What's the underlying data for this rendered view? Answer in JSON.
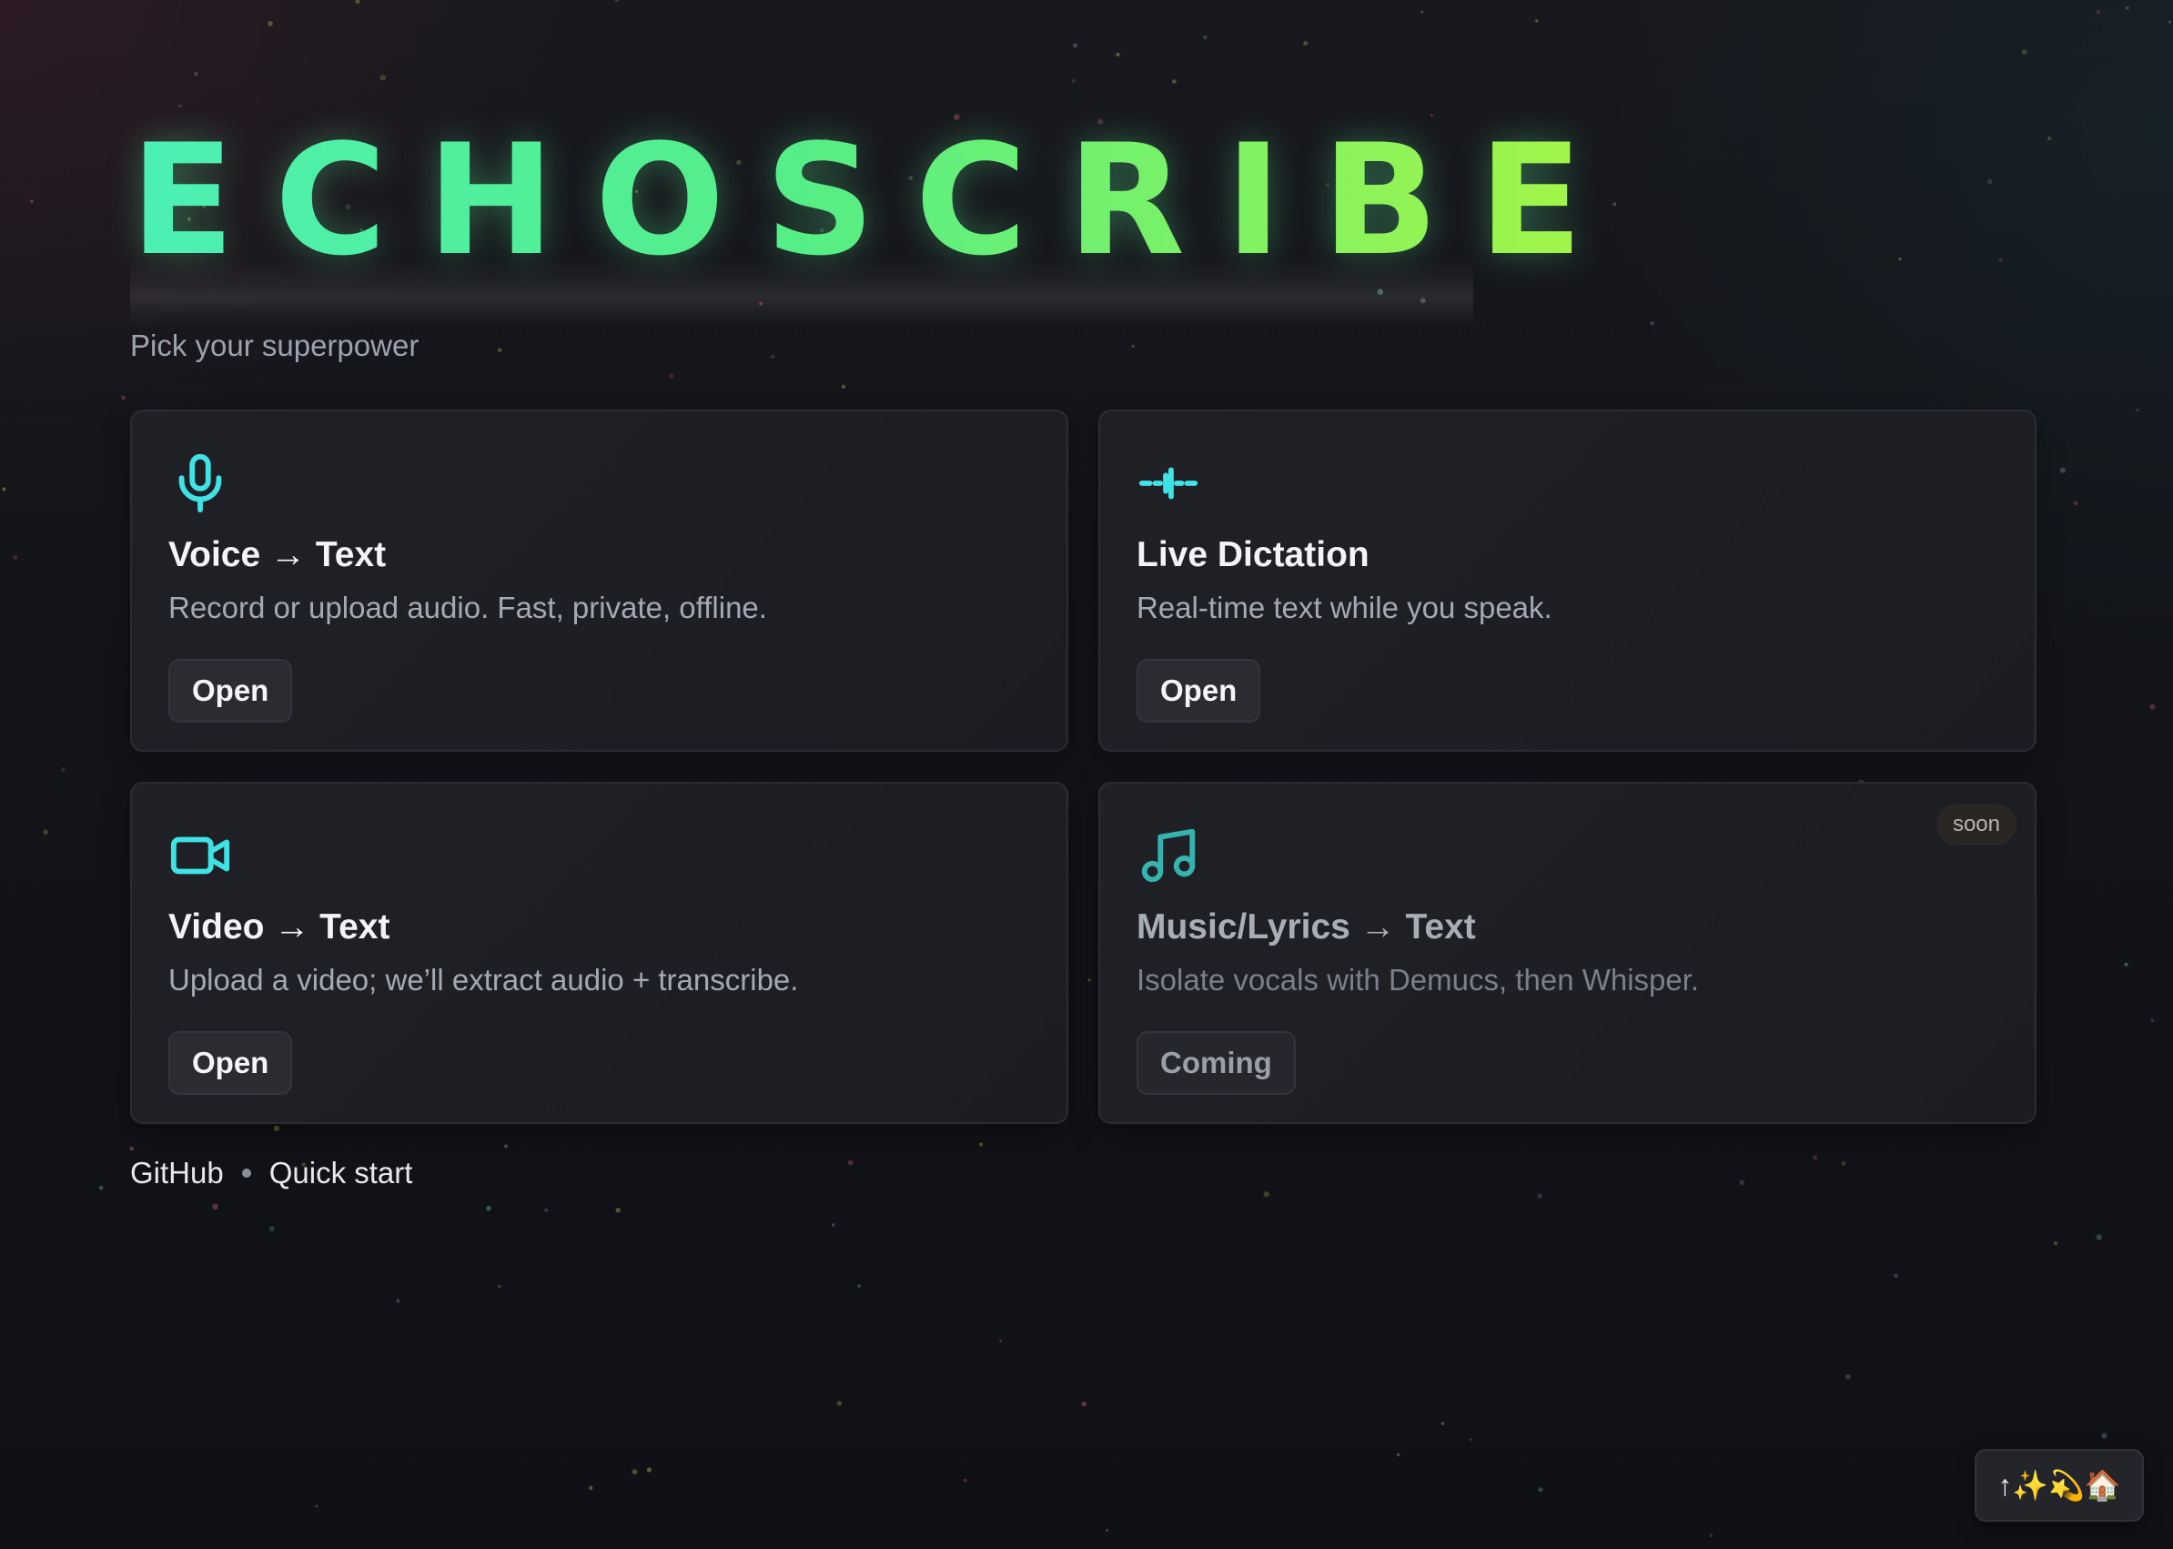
{
  "brand": {
    "title": "ECHOSCRIBE",
    "subtitle": "Pick your superpower"
  },
  "cards": [
    {
      "icon": "microphone-icon",
      "title": "Voice → Text",
      "description": "Record or upload audio. Fast, private, offline.",
      "button": "Open"
    },
    {
      "icon": "waveform-icon",
      "title": "Live Dictation",
      "description": "Real-time text while you speak.",
      "button": "Open"
    },
    {
      "icon": "video-camera-icon",
      "title": "Video → Text",
      "description": "Upload a video; we’ll extract audio + transcribe.",
      "button": "Open"
    },
    {
      "icon": "music-note-icon",
      "title": "Music/Lyrics → Text",
      "description": "Isolate vocals with Demucs, then Whisper.",
      "button": "Coming",
      "badge": "soon"
    }
  ],
  "footer": {
    "links": [
      "GitHub",
      "Quick start"
    ]
  },
  "fab": {
    "label": "↑✨💫🏠"
  },
  "colors": {
    "accent": "#3fe3e6",
    "title_gradient_start": "#4cf0b4",
    "title_gradient_end": "#a6f545",
    "background": "#121419"
  }
}
